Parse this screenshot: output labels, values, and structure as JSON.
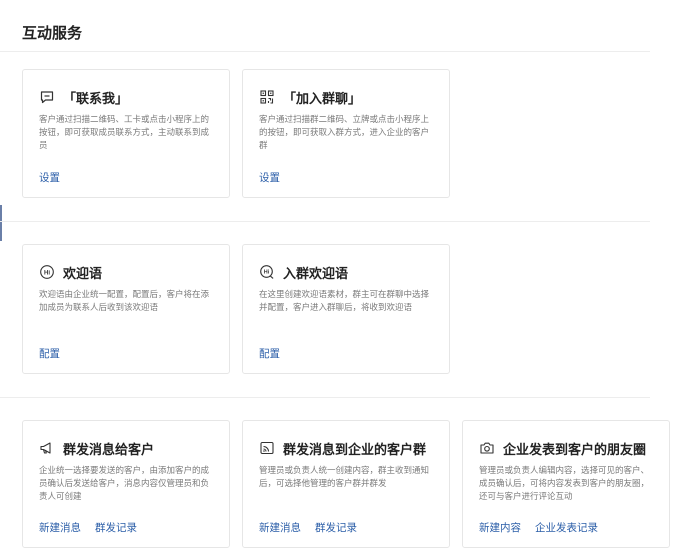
{
  "page": {
    "title": "互动服务"
  },
  "sections": [
    {
      "cards": [
        {
          "icon": "chat-bubble-icon",
          "title": "「联系我」",
          "desc": "客户通过扫描二维码、工卡或点击小程序上的按钮，即可获取成员联系方式，主动联系到成员",
          "actions": [
            "设置"
          ]
        },
        {
          "icon": "qr-code-icon",
          "title": "「加入群聊」",
          "desc": "客户通过扫描群二维码、立牌或点击小程序上的按钮，即可获取入群方式，进入企业的客户群",
          "actions": [
            "设置"
          ]
        }
      ]
    },
    {
      "cards": [
        {
          "icon": "hi-badge-icon",
          "title": "欢迎语",
          "desc": "欢迎语由企业统一配置，配置后，客户将在添加成员为联系人后收到该欢迎语",
          "actions": [
            "配置"
          ]
        },
        {
          "icon": "group-hi-badge-icon",
          "title": "入群欢迎语",
          "desc": "在这里创建欢迎语素材，群主可在群聊中选择并配置，客户进入群聊后，将收到欢迎语",
          "actions": [
            "配置"
          ]
        }
      ]
    },
    {
      "cards": [
        {
          "icon": "megaphone-icon",
          "title": "群发消息给客户",
          "desc": "企业统一选择要发送的客户，由添加客户的成员确认后发送给客户，消息内容仅管理员和负责人可创建",
          "actions": [
            "新建消息",
            "群发记录"
          ]
        },
        {
          "icon": "group-broadcast-icon",
          "title": "群发消息到企业的客户群",
          "desc": "管理员或负责人统一创建内容，群主收到通知后，可选择他管理的客户群并群发",
          "actions": [
            "新建消息",
            "群发记录"
          ]
        },
        {
          "icon": "camera-icon",
          "title": "企业发表到客户的朋友圈",
          "desc": "管理员或负责人编辑内容，选择可见的客户、成员确认后，可将内容发表到客户的朋友圈，还可与客户进行评论互动",
          "actions": [
            "新建内容",
            "企业发表记录"
          ]
        }
      ]
    }
  ]
}
